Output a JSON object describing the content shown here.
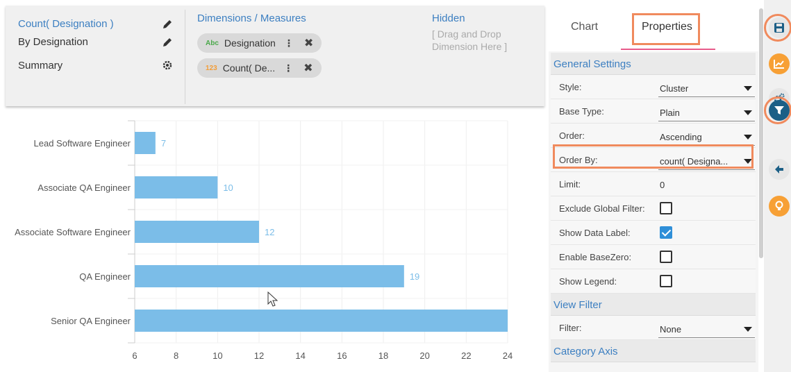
{
  "config": {
    "rows": [
      {
        "label": "Count( Designation )"
      },
      {
        "label": "By Designation"
      },
      {
        "label": "Summary"
      }
    ],
    "dimensions_header": "Dimensions / Measures",
    "pills": [
      {
        "type_tag": "Abc",
        "label": "Designation"
      },
      {
        "type_tag": "123",
        "label": "Count( De..."
      }
    ],
    "hidden_header": "Hidden",
    "hidden_placeholder": "[ Drag and Drop Dimension Here ]"
  },
  "tabs": {
    "chart": "Chart",
    "properties": "Properties"
  },
  "properties": {
    "general_settings": "General Settings",
    "style_label": "Style:",
    "style_value": "Cluster",
    "base_type_label": "Base Type:",
    "base_type_value": "Plain",
    "order_label": "Order:",
    "order_value": "Ascending",
    "order_by_label": "Order By:",
    "order_by_value": "count( Designa...",
    "limit_label": "Limit:",
    "limit_value": "0",
    "exclude_global_filter_label": "Exclude Global Filter:",
    "exclude_global_filter": false,
    "show_data_label_label": "Show Data Label:",
    "show_data_label": true,
    "enable_basezero_label": "Enable BaseZero:",
    "enable_basezero": false,
    "show_legend_label": "Show Legend:",
    "show_legend": false,
    "view_filter": "View Filter",
    "filter_label": "Filter:",
    "filter_value": "None",
    "category_axis": "Category Axis"
  },
  "colors": {
    "accent": "#3c7fc1",
    "bar": "#7bbde8",
    "highlight": "#f08a5d",
    "rail_orange": "#f7a035",
    "rail_navy": "#1c5f86"
  },
  "rail_icons": [
    "save-icon",
    "chart-trend-icon",
    "settings-gears-icon",
    "filter-icon",
    "back-arrow-icon",
    "lightbulb-icon"
  ],
  "chart_data": {
    "type": "bar",
    "orientation": "horizontal",
    "categories": [
      "Lead Software Engineer",
      "Associate QA Engineer",
      "Associate Software Engineer",
      "QA Engineer",
      "Senior QA Engineer"
    ],
    "values": [
      7,
      10,
      12,
      19,
      24
    ],
    "data_labels": [
      "7",
      "10",
      "12",
      "19",
      ""
    ],
    "xlim": [
      6,
      24
    ],
    "xticks": [
      6,
      8,
      10,
      12,
      14,
      16,
      18,
      20,
      22,
      24
    ],
    "grid": true,
    "legend": false
  }
}
